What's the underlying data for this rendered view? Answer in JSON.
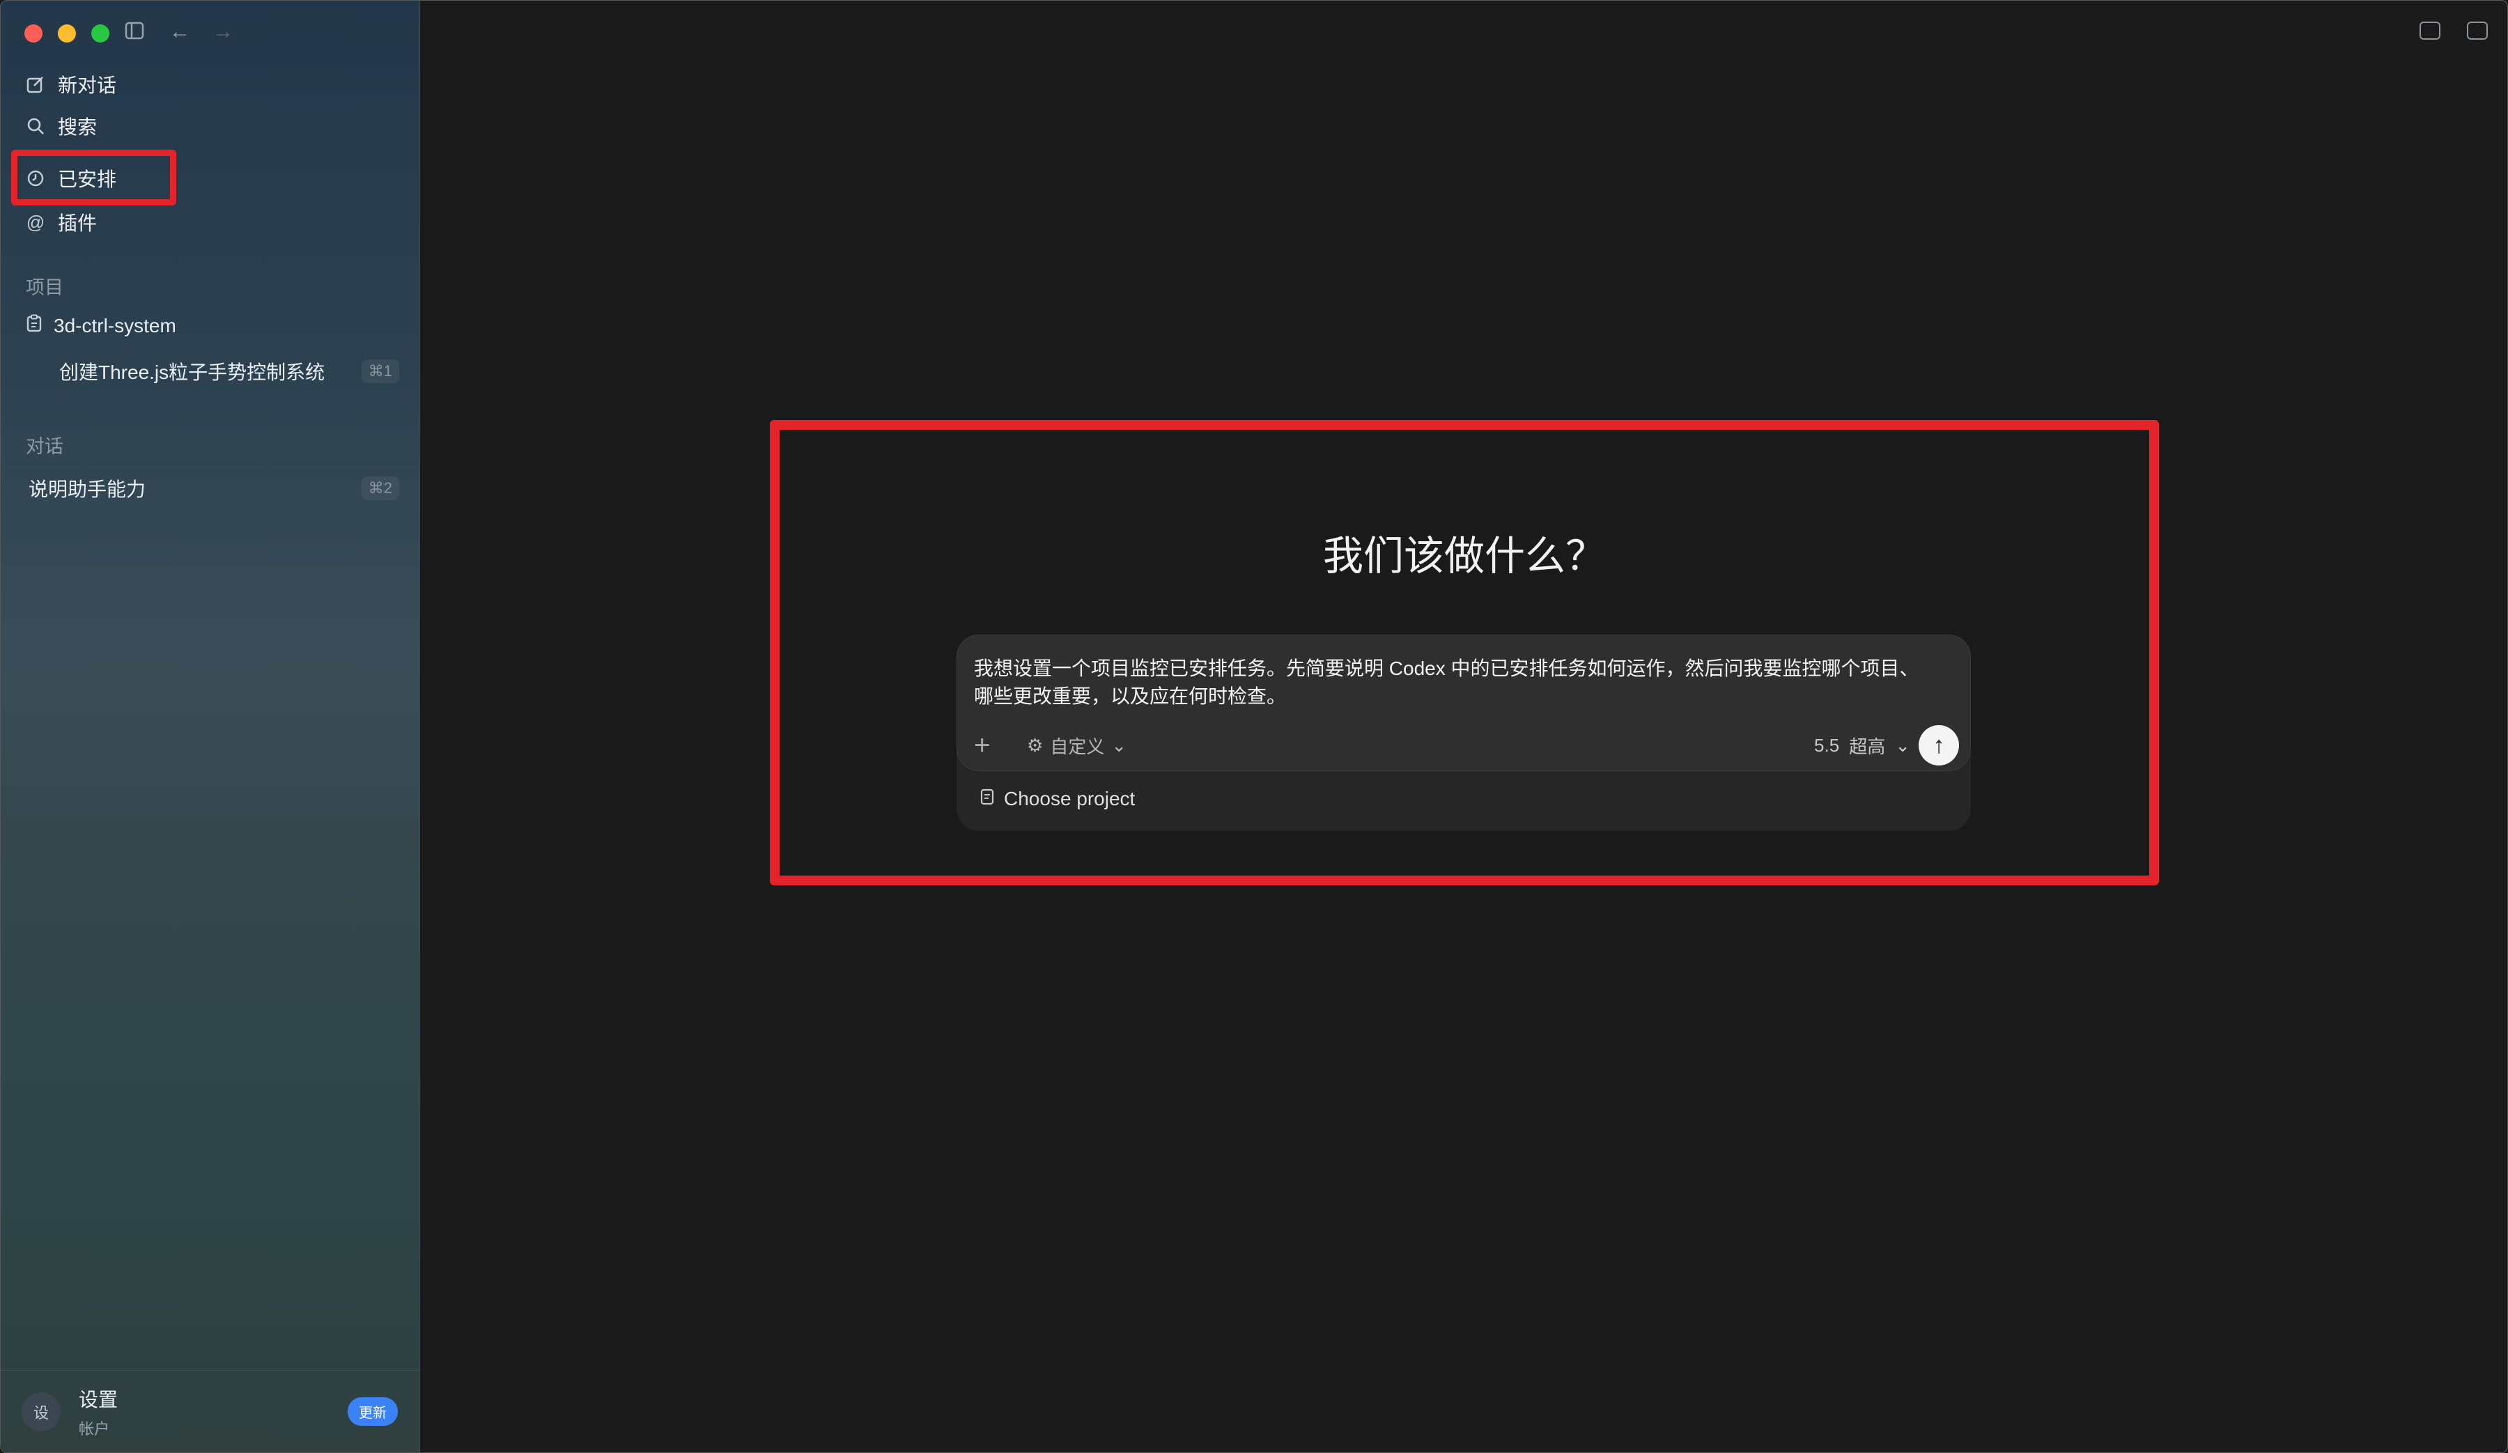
{
  "sidebar": {
    "nav": [
      {
        "label": "新对话",
        "icon": "edit-icon"
      },
      {
        "label": "搜索",
        "icon": "search-icon"
      },
      {
        "label": "已安排",
        "icon": "clock-icon"
      },
      {
        "label": "插件",
        "icon": "at-icon"
      }
    ],
    "projects_label": "项目",
    "project": {
      "name": "3d-ctrl-system",
      "icon": "clipboard-icon"
    },
    "project_thread": {
      "title": "创建Three.js粒子手势控制系统",
      "shortcut": "⌘1"
    },
    "conversations_label": "对话",
    "conversation": {
      "title": "说明助手能力",
      "shortcut": "⌘2"
    },
    "footer": {
      "avatar": "设",
      "name": "设置",
      "sub": "帐户",
      "badge": "更新"
    }
  },
  "main": {
    "heading": "我们该做什么？",
    "prompt": "我想设置一个项目监控已安排任务。先简要说明 Codex 中的已安排任务如何运作，然后问我要监控哪个项目、哪些更改重要，以及应在何时检查。",
    "mode_label": "自定义",
    "model_version": "5.5",
    "model_level": "超高",
    "choose_project": "Choose project"
  },
  "colors": {
    "highlight": "#e3242b",
    "badge": "#3b82f6"
  }
}
